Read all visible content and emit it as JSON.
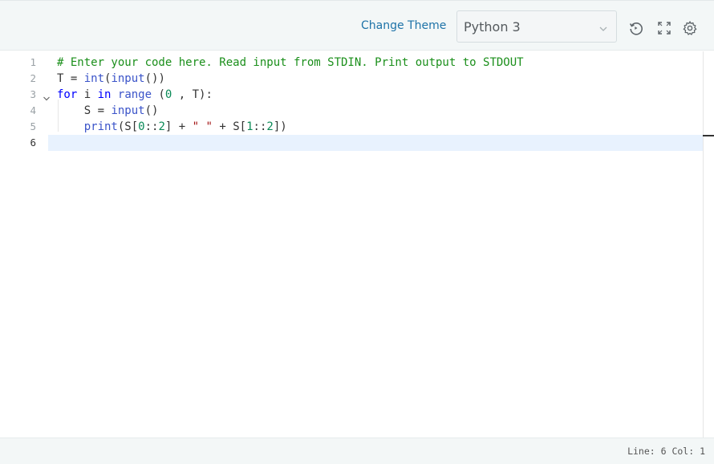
{
  "toolbar": {
    "change_theme_label": "Change Theme",
    "language": "Python 3",
    "icons": [
      "history-icon",
      "fullscreen-icon",
      "settings-icon"
    ]
  },
  "editor": {
    "line_numbers": [
      "1",
      "2",
      "3",
      "4",
      "5",
      "6"
    ],
    "lines": [
      [
        {
          "t": "comment",
          "s": "# Enter your code here. Read input from STDIN. Print output to STDOUT"
        }
      ],
      [
        {
          "t": "txt",
          "s": "T = "
        },
        {
          "t": "fn",
          "s": "int"
        },
        {
          "t": "txt",
          "s": "("
        },
        {
          "t": "fn",
          "s": "input"
        },
        {
          "t": "txt",
          "s": "())"
        }
      ],
      [
        {
          "t": "kw",
          "s": "for"
        },
        {
          "t": "txt",
          "s": " i "
        },
        {
          "t": "kw",
          "s": "in"
        },
        {
          "t": "txt",
          "s": " "
        },
        {
          "t": "fn",
          "s": "range"
        },
        {
          "t": "txt",
          "s": " ("
        },
        {
          "t": "num",
          "s": "0"
        },
        {
          "t": "txt",
          "s": " , T):"
        }
      ],
      [
        {
          "t": "txt",
          "s": "    S = "
        },
        {
          "t": "fn",
          "s": "input"
        },
        {
          "t": "txt",
          "s": "()"
        }
      ],
      [
        {
          "t": "txt",
          "s": "    "
        },
        {
          "t": "fn",
          "s": "print"
        },
        {
          "t": "txt",
          "s": "(S["
        },
        {
          "t": "num",
          "s": "0"
        },
        {
          "t": "txt",
          "s": "::"
        },
        {
          "t": "num",
          "s": "2"
        },
        {
          "t": "txt",
          "s": "] + "
        },
        {
          "t": "str",
          "s": "\" \""
        },
        {
          "t": "txt",
          "s": " + S["
        },
        {
          "t": "num",
          "s": "1"
        },
        {
          "t": "txt",
          "s": "::"
        },
        {
          "t": "num",
          "s": "2"
        },
        {
          "t": "txt",
          "s": "])"
        }
      ],
      []
    ]
  },
  "status": {
    "text": "Line: 6 Col: 1"
  },
  "colors": {
    "comment": "#1b8f1b",
    "keyword": "#0000ff",
    "function": "#3b54c9",
    "number": "#0a8a57",
    "string": "#a31515",
    "link": "#1e73a8"
  }
}
